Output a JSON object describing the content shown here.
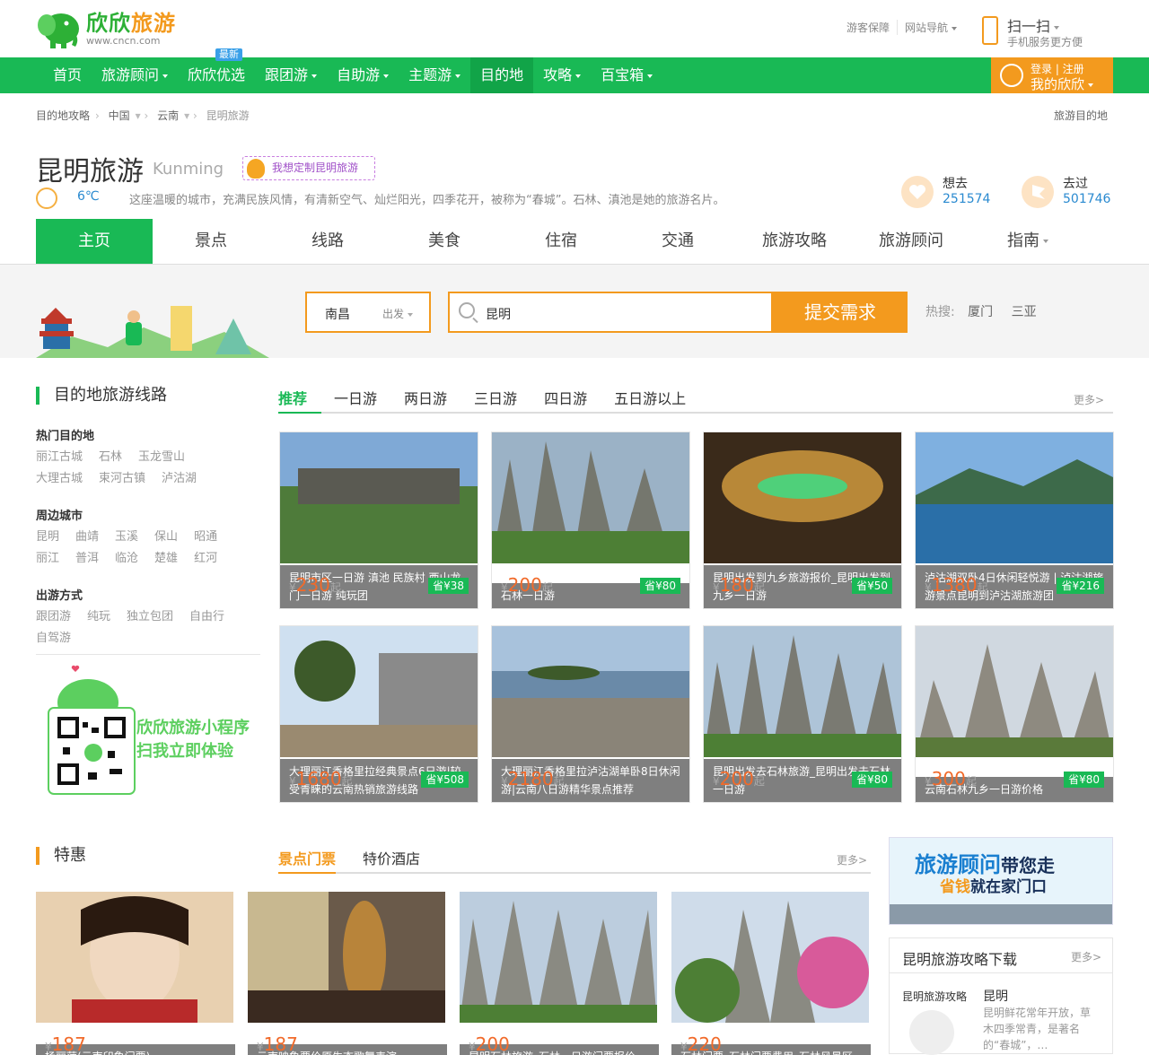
{
  "header": {
    "logo_cn_a": "欣欣",
    "logo_cn_b": "旅游",
    "logo_url": "www.cncn.com",
    "links": [
      "游客保障",
      "网站导航"
    ],
    "scan_title": "扫一扫",
    "scan_sub": "手机服务更方便"
  },
  "nav": {
    "items": [
      {
        "label": "首页",
        "caret": false
      },
      {
        "label": "旅游顾问",
        "caret": true
      },
      {
        "label": "欣欣优选",
        "caret": false
      },
      {
        "label": "跟团游",
        "caret": true
      },
      {
        "label": "自助游",
        "caret": true
      },
      {
        "label": "主题游",
        "caret": true
      },
      {
        "label": "目的地",
        "caret": false
      },
      {
        "label": "攻略",
        "caret": true
      },
      {
        "label": "百宝箱",
        "caret": true
      }
    ],
    "badge": "最新",
    "login_small": "登录 | 注册",
    "login_big": "我的欣欣"
  },
  "breadcrumb": {
    "items": [
      "目的地攻略",
      "中国",
      "云南",
      "昆明旅游"
    ],
    "right": "旅游目的地"
  },
  "city": {
    "name": "昆明旅游",
    "en": "Kunming",
    "custom": "我想定制昆明旅游",
    "temp": "6℃",
    "desc": "这座温暖的城市，充满民族风情，有清新空气、灿烂阳光，四季花开，被称为“春城”。石林、滇池是她的旅游名片。",
    "want_label": "想去",
    "want_val": "251574",
    "been_label": "去过",
    "been_val": "501746"
  },
  "city_tabs": [
    "主页",
    "景点",
    "线路",
    "美食",
    "住宿",
    "交通",
    "旅游攻略",
    "旅游顾问",
    "指南"
  ],
  "search": {
    "from_city": "南昌",
    "from_label": "出发",
    "query": "昆明",
    "submit": "提交需求",
    "hot_label": "热搜:",
    "hot": [
      "厦门",
      "三亚"
    ]
  },
  "routes": {
    "title": "目的地旅游线路",
    "tabs": [
      "推荐",
      "一日游",
      "两日游",
      "三日游",
      "四日游",
      "五日游以上"
    ],
    "more": "更多>",
    "filters": [
      {
        "title": "热门目的地",
        "rows": [
          [
            "丽江古城",
            "石林",
            "玉龙雪山"
          ],
          [
            "大理古城",
            "束河古镇",
            "泸沽湖"
          ]
        ]
      },
      {
        "title": "周边城市",
        "rows": [
          [
            "昆明",
            "曲靖",
            "玉溪",
            "保山",
            "昭通"
          ],
          [
            "丽江",
            "普洱",
            "临沧",
            "楚雄",
            "红河"
          ]
        ]
      },
      {
        "title": "出游方式",
        "rows": [
          [
            "跟团游",
            "纯玩",
            "独立包团",
            "自由行"
          ],
          [
            "自驾游"
          ]
        ]
      }
    ],
    "qr_line1": "欣欣旅游小程序",
    "qr_line2": "扫我立即体验",
    "cards": [
      {
        "cap": "昆明市区一日游 滇池 民族村 西山龙门一日游 纯玩团",
        "price": "230",
        "save": "省¥38"
      },
      {
        "cap": "石林一日游",
        "price": "200",
        "save": "省¥80"
      },
      {
        "cap": "昆明出发到九乡旅游报价_昆明出发到九乡一日游",
        "price": "180",
        "save": "省¥50"
      },
      {
        "cap": "泸沽湖双卧4日休闲轻悦游 | 泸沽湖旅游景点昆明到泸沽湖旅游团",
        "price": "1380",
        "save": "省¥216"
      },
      {
        "cap": "大理丽江香格里拉经典景点6日游|较受青睐的云南热销旅游线路",
        "price": "1680",
        "save": "省¥508"
      },
      {
        "cap": "大理丽江香格里拉泸沽湖单卧8日休闲游|云南八日游精华景点推荐",
        "price": "2180",
        "save": ""
      },
      {
        "cap": "昆明出发去石林旅游_昆明出发去石林一日游",
        "price": "200",
        "save": "省¥80"
      },
      {
        "cap": "云南石林九乡一日游价格",
        "price": "300",
        "save": "省¥80"
      }
    ],
    "yen": "¥",
    "qi": "起"
  },
  "deals": {
    "title": "特惠",
    "tabs": [
      "景点门票",
      "特价酒店"
    ],
    "more": "更多>",
    "cards": [
      {
        "cap": "杨丽萍(云南印象门票)",
        "price": "187"
      },
      {
        "cap": "云南映象票价原生态歌舞表演",
        "price": "187"
      },
      {
        "cap": "昆明石林旅游_石林一日游门票报价",
        "price": "200"
      },
      {
        "cap": "石林门票_石林门票费用_石林风景区",
        "price": "220"
      }
    ]
  },
  "sidebar": {
    "ad_line1a": "旅游顾问",
    "ad_line1b": "带您走",
    "ad_line2a": "省钱",
    "ad_line2b": "就在家门口",
    "dl_title": "昆明旅游攻略下载",
    "dl_more": "更多>",
    "dl_book": "昆明旅游攻略",
    "dl_city": "昆明",
    "dl_desc": "昆明鲜花常年开放，草木四季常青，是著名的“春城”，…"
  },
  "colors": {
    "green": "#19b955",
    "orange": "#f39a1e",
    "price": "#f16a2a",
    "blue": "#2a8ad0"
  }
}
